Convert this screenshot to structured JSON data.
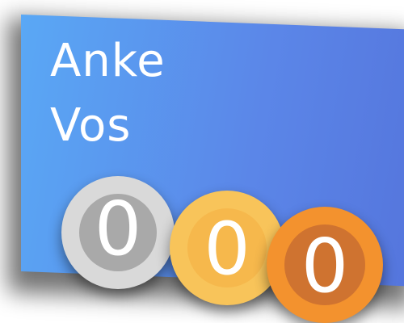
{
  "profile": {
    "first_name": "Anke",
    "last_name": "Vos"
  },
  "medals": {
    "silver": {
      "count": "0",
      "color": "#a9a9a9",
      "ring_color": "#d9d9d9"
    },
    "gold": {
      "count": "0",
      "color": "#f6b84c",
      "ring_color": "#f8c45a"
    },
    "bronze": {
      "count": "0",
      "color": "#cf7330",
      "ring_color": "#f3922e"
    }
  },
  "colors": {
    "card_gradient_start": "#5aa8f5",
    "card_gradient_end": "#5576dd",
    "text": "#ffffff"
  }
}
